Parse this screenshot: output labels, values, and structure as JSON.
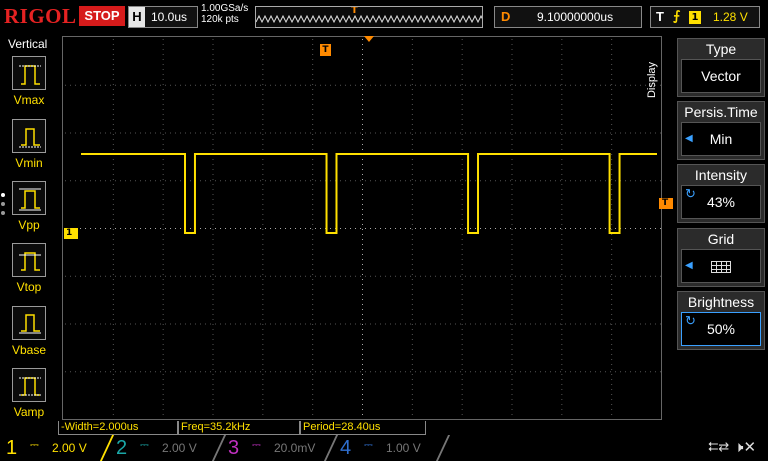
{
  "topbar": {
    "brand": "RIGOL",
    "run_state": "STOP",
    "horizontal_label": "H",
    "timebase": "10.0us",
    "sample_rate": "1.00GSa/s",
    "memory_depth": "120k pts",
    "delay_label": "D",
    "delay_value": "9.10000000us",
    "trigger_label": "T",
    "trigger_edge": "rising-edge-icon",
    "trigger_source": "1",
    "trigger_level": "1.28 V"
  },
  "left_panel": {
    "title": "Vertical",
    "items": [
      {
        "label": "Vmax",
        "icon": "vmax-icon"
      },
      {
        "label": "Vmin",
        "icon": "vmin-icon"
      },
      {
        "label": "Vpp",
        "icon": "vpp-icon"
      },
      {
        "label": "Vtop",
        "icon": "vtop-icon"
      },
      {
        "label": "Vbase",
        "icon": "vbase-icon"
      },
      {
        "label": "Vamp",
        "icon": "vamp-icon"
      }
    ]
  },
  "markers": {
    "channel1": "1",
    "trigger_pos": "T",
    "trigger_level": "T"
  },
  "waveform": {
    "color": "#ffe000",
    "pulse_width_us": 2.0,
    "period_us": 28.4
  },
  "right_menu": {
    "tab": "Display",
    "items": [
      {
        "title": "Type",
        "value": "Vector"
      },
      {
        "title": "Persis.Time",
        "value": "Min"
      },
      {
        "title": "Intensity",
        "value": "43%"
      },
      {
        "title": "Grid",
        "value": ""
      },
      {
        "title": "Brightness",
        "value": "50%"
      }
    ]
  },
  "measurements": {
    "width": "-Width=2.000us",
    "freq": "Freq=35.2kHz",
    "period": "Period=28.40us"
  },
  "channels": [
    {
      "num": "1",
      "scale": "2.00 V",
      "color": "#ffe000"
    },
    {
      "num": "2",
      "scale": "2.00 V",
      "color": "#1aa7a7"
    },
    {
      "num": "3",
      "scale": "20.0mV",
      "color": "#c030c0"
    },
    {
      "num": "4",
      "scale": "1.00 V",
      "color": "#2f6fd0"
    }
  ],
  "status_icons": [
    "usb-icon",
    "speaker-mute-icon"
  ]
}
